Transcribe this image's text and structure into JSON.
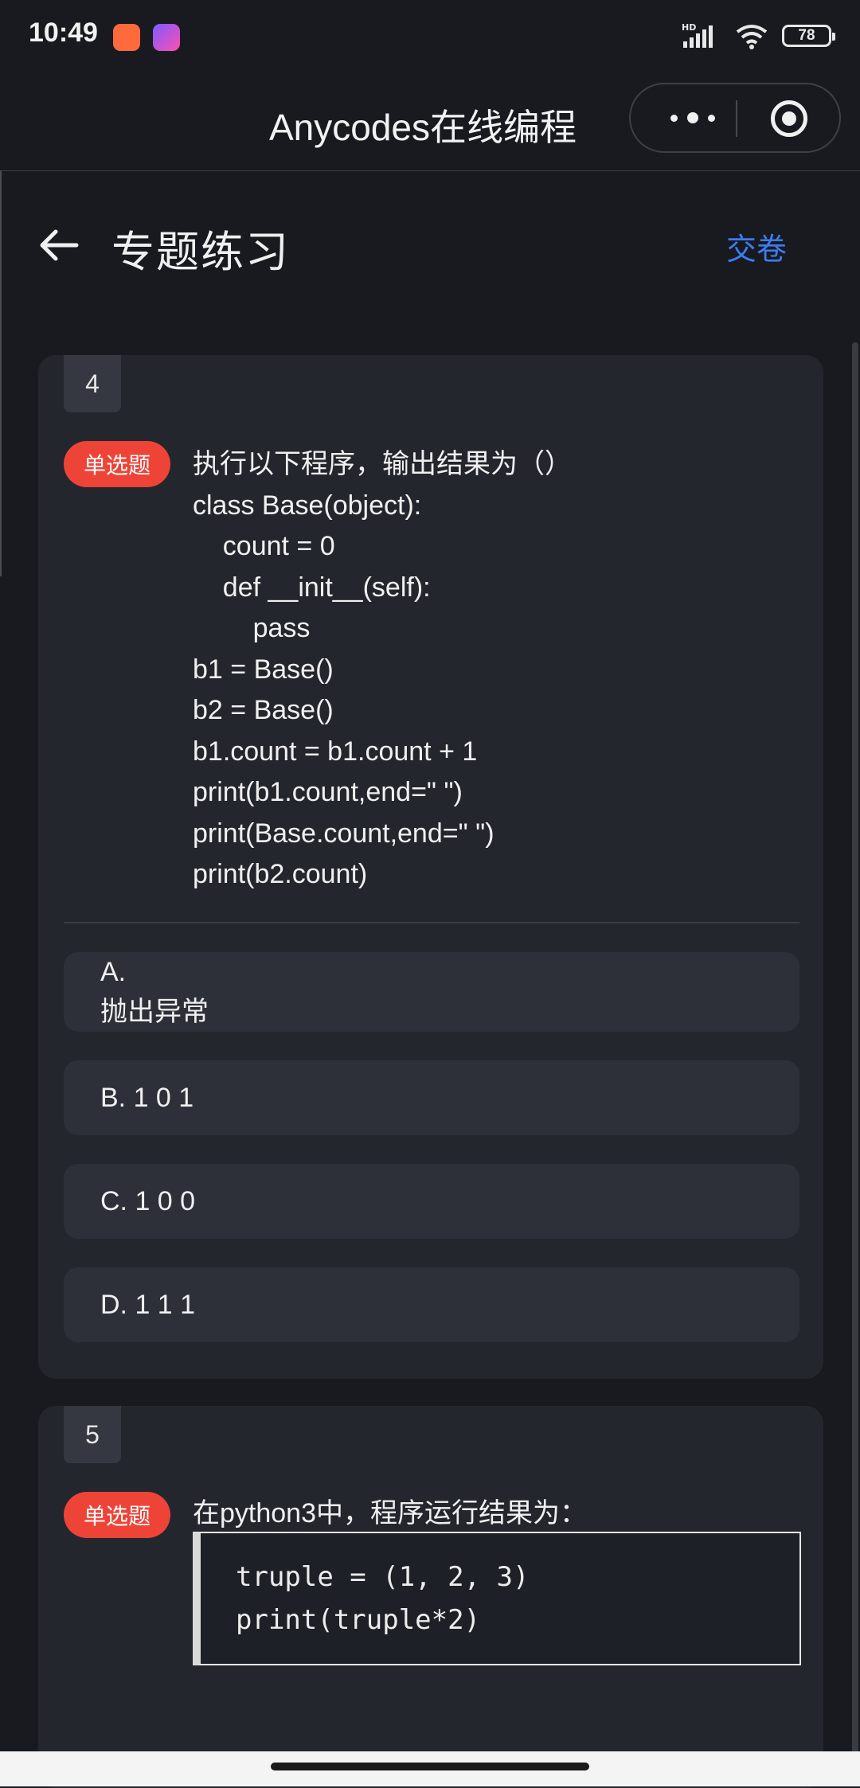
{
  "status_bar": {
    "time": "10:49",
    "network": "HD",
    "battery": "78"
  },
  "mini_program": {
    "title": "Anycodes在线编程"
  },
  "header": {
    "title": "专题练习",
    "submit": "交卷"
  },
  "questions": [
    {
      "number": "4",
      "type": "单选题",
      "text_lines": [
        "执行以下程序，输出结果为（）",
        "class Base(object):",
        "    count = 0",
        "    def __init__(self):",
        "        pass",
        "b1 = Base()",
        "b2 = Base()",
        "b1.count = b1.count + 1",
        "print(b1.count,end=\" \")",
        "print(Base.count,end=\" \")",
        "print(b2.count)"
      ],
      "options": [
        {
          "letter": "A.",
          "text": "抛出异常"
        },
        {
          "label": "B. 1 0 1"
        },
        {
          "label": "C. 1 0 0"
        },
        {
          "label": "D. 1 1 1"
        }
      ]
    },
    {
      "number": "5",
      "type": "单选题",
      "text": "在python3中，程序运行结果为：",
      "code_lines": [
        "truple = (1, 2, 3)",
        "print(truple*2)"
      ]
    }
  ]
}
